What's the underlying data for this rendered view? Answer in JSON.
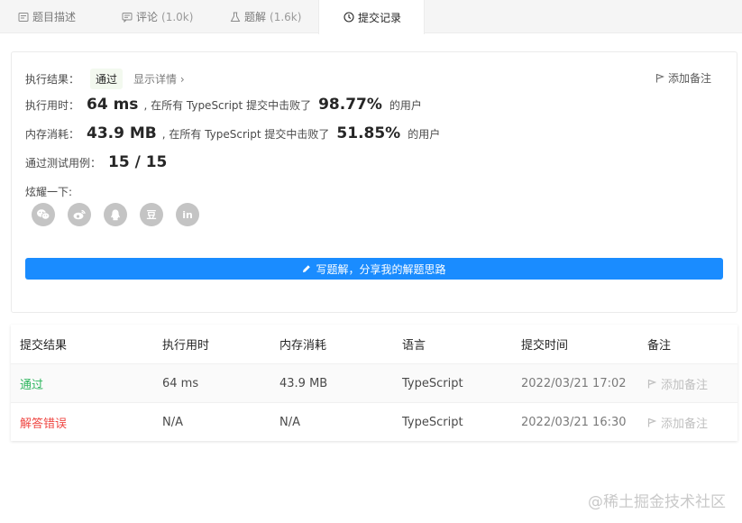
{
  "tabs": [
    {
      "label": "题目描述",
      "count": "",
      "icon": "description-icon"
    },
    {
      "label": "评论",
      "count": "(1.0k)",
      "icon": "comment-icon"
    },
    {
      "label": "题解",
      "count": "(1.6k)",
      "icon": "flask-icon"
    },
    {
      "label": "提交记录",
      "count": "",
      "icon": "clock-icon"
    }
  ],
  "result": {
    "status_label": "执行结果：",
    "status_value": "通过",
    "details_link": "显示详情 ›",
    "add_note": "添加备注",
    "runtime_label": "执行用时：",
    "runtime_value": "64 ms",
    "runtime_text": ", 在所有 TypeScript 提交中击败了",
    "runtime_pct": "98.77%",
    "runtime_suffix": "的用户",
    "memory_label": "内存消耗：",
    "memory_value": "43.9 MB",
    "memory_text": ", 在所有 TypeScript 提交中击败了",
    "memory_pct": "51.85%",
    "memory_suffix": "的用户",
    "tests_label": "通过测试用例：",
    "tests_value": "15 / 15",
    "share_label": "炫耀一下:",
    "share": [
      {
        "icon": "wechat-icon",
        "text": ""
      },
      {
        "icon": "weibo-icon",
        "text": ""
      },
      {
        "icon": "qq-icon",
        "text": ""
      },
      {
        "icon": "douban-icon",
        "text": "豆"
      },
      {
        "icon": "linkedin-icon",
        "text": "in"
      }
    ],
    "write_button": "写题解，分享我的解题思路"
  },
  "table": {
    "headers": [
      "提交结果",
      "执行用时",
      "内存消耗",
      "语言",
      "提交时间",
      "备注"
    ],
    "rows": [
      {
        "result": "通过",
        "runtime": "64 ms",
        "memory": "43.9 MB",
        "lang": "TypeScript",
        "time": "2022/03/21 17:02",
        "note": "添加备注",
        "status": "ok"
      },
      {
        "result": "解答错误",
        "runtime": "N/A",
        "memory": "N/A",
        "lang": "TypeScript",
        "time": "2022/03/21 16:30",
        "note": "添加备注",
        "status": "err"
      }
    ]
  },
  "watermark": "@稀土掘金技术社区",
  "colors": {
    "accent": "#1a8cff",
    "success": "#2db55d",
    "error": "#ef4743"
  }
}
